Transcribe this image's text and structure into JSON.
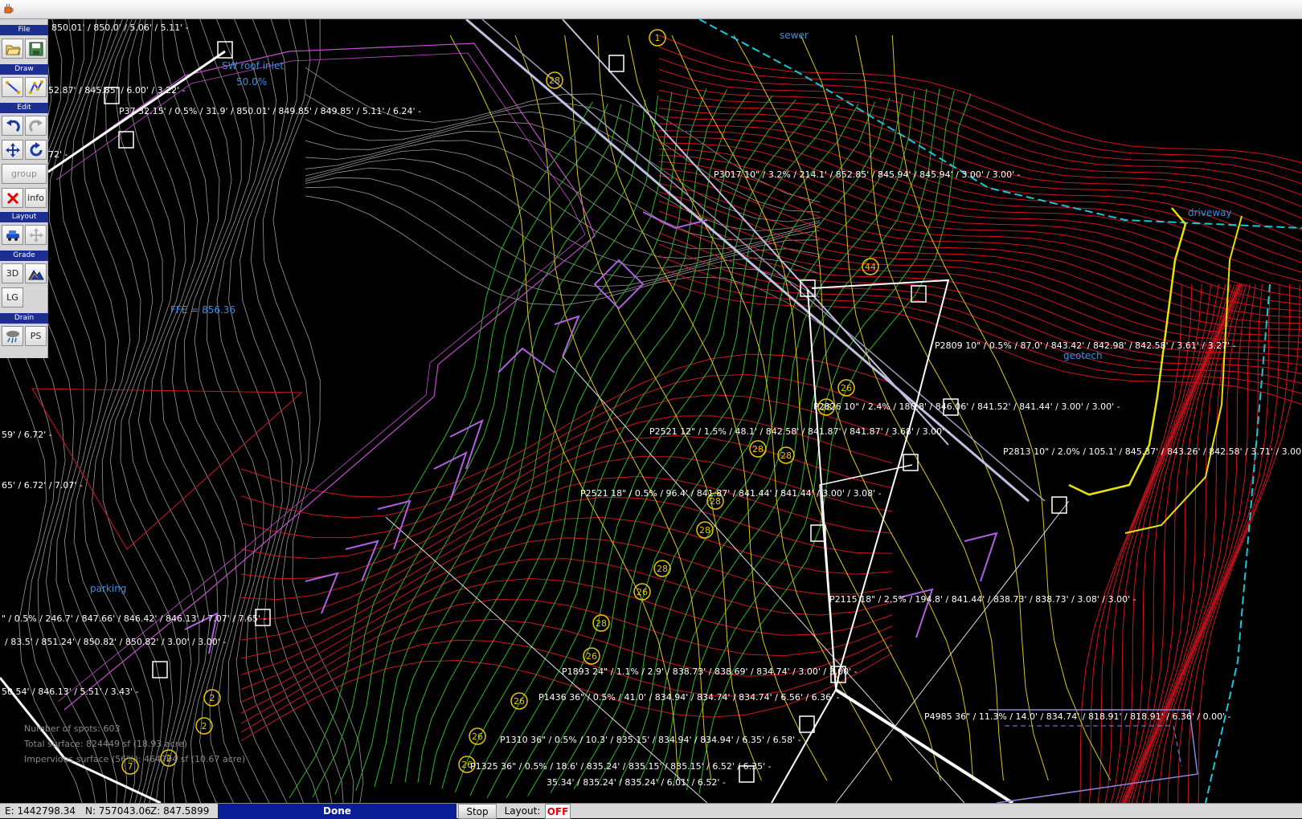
{
  "window": {
    "icon": "java-coffee-icon"
  },
  "toolbar": {
    "file": {
      "title": "File",
      "icons": [
        "open-folder-icon",
        "save-disk-icon"
      ]
    },
    "draw": {
      "title": "Draw",
      "icons": [
        "draw-line-icon",
        "draw-polyline-icon"
      ]
    },
    "edit": {
      "title": "Edit",
      "icons": [
        "undo-icon",
        "redo-icon",
        "move-icon",
        "rotate-icon"
      ],
      "group_label": "group",
      "delete_icon": "delete-x-icon",
      "info_label": "info"
    },
    "layout": {
      "title": "Layout",
      "icons": [
        "layout-car-icon",
        "layout-move-icon"
      ]
    },
    "grade": {
      "title": "Grade",
      "btn_3d": "3D",
      "terrain_icon": "terrain-icon",
      "lg_label": "LG"
    },
    "drain": {
      "title": "Drain",
      "icon": "storm-drain-icon",
      "ps_label": "PS"
    }
  },
  "canvas": {
    "labels": [
      {
        "text": "850.01' / 850.0' / 5.06' / 5.11' -",
        "style": "white"
      },
      {
        "text": "SW roof inlet",
        "style": "blue"
      },
      {
        "text": "50.0%",
        "style": "blue"
      },
      {
        "text": "52.87' / 845.85' / 6.00' / 3.22' -",
        "style": "white"
      },
      {
        "text": "P37 32.15' / 0.5% / 31.9' / 850.01' / 849.85' / 849.85' / 5.11' / 6.24' -",
        "style": "white"
      },
      {
        "text": "72' -",
        "style": "white"
      },
      {
        "text": "sewer",
        "style": "blue"
      },
      {
        "text": "P3017 10\" / 3.2% / 214.1' / 852.85' / 845.94' / 845.94' / 3.00' / 3.00' -",
        "style": "white"
      },
      {
        "text": "driveway",
        "style": "blue"
      },
      {
        "text": "FFE = 856.36",
        "style": "blue"
      },
      {
        "text": "P2809 10\" / 0.5% / 87.0' / 843.42' / 842.98' / 842.58' / 3.61' / 3.27' -",
        "style": "white"
      },
      {
        "text": "geotech",
        "style": "blue"
      },
      {
        "text": "P2826 10\" / 2.4% / 180.8' / 846.06' / 841.52' / 841.44' / 3.00' / 3.00' -",
        "style": "white"
      },
      {
        "text": "P2521 12\" / 1.5% / 48.1' / 842.58' / 841.87' / 841.87' / 3.68' / 3.00' -",
        "style": "white"
      },
      {
        "text": "59' / 6.72' -",
        "style": "white"
      },
      {
        "text": "P2813 10\" / 2.0% / 105.1' / 845.37' / 843.26' / 842.58' / 3.71' / 3.00' -",
        "style": "white"
      },
      {
        "text": "65' / 6.72' / 7.07' -",
        "style": "white"
      },
      {
        "text": "P2521 18\" / 0.5% / 96.4' / 841.87' / 841.44' / 841.44' / 3.00' / 3.08' -",
        "style": "white"
      },
      {
        "text": "parking",
        "style": "blue"
      },
      {
        "text": "\" / 0.5% / 246.7' / 847.66' / 846.42' / 846.13' / 7.07' / 7.65' -",
        "style": "white"
      },
      {
        "text": "P2115 18\" / 2.5% / 194.8' / 841.44' / 838.73' / 838.73' / 3.08' / 3.00' -",
        "style": "white"
      },
      {
        "text": "/ 83.5' / 851.24' / 850.82' / 850.82' / 3.00' / 3.00' -",
        "style": "white"
      },
      {
        "text": "P1893 24\" / 1.1% / 2.9' / 838.73' / 838.69' / 834.74' / 3.00' / 3.00' -",
        "style": "white"
      },
      {
        "text": "50.54' / 846.13' / 5.51' / 3.43' -",
        "style": "white"
      },
      {
        "text": "P1436 36\" / 0.5% / 41.0' / 834.94' / 834.74' / 834.74' / 6.56' / 6.36' -",
        "style": "white"
      },
      {
        "text": "P4985 36\" / 11.3% / 14.0' / 834.74' / 818.91' / 818.91' / 6.36' / 0.00' -",
        "style": "white"
      },
      {
        "text": "Number of spots: 603",
        "style": "gray"
      },
      {
        "text": "Total surface: 824449 sf (18.93 acre)",
        "style": "gray"
      },
      {
        "text": "Impervious surface (56%): 464794 sf (10.67 acre)",
        "style": "gray"
      },
      {
        "text": "P1310 36\" / 0.5% / 10.3' / 835.15' / 834.94' / 834.94' / 6.35' / 6.58' -",
        "style": "white"
      },
      {
        "text": "P1325 36\" / 0.5% / 18.6' / 835.24' / 835.15' / 835.15' / 6.52' / 6.35' -",
        "style": "white"
      },
      {
        "text": "35.34' / 835.24' / 835.24' / 6.01' / 6.52' -",
        "style": "white"
      }
    ],
    "markers": [
      "1",
      "28",
      "44",
      "26",
      "28",
      "28",
      "28",
      "28",
      "28",
      "28",
      "26",
      "28",
      "26",
      "26",
      "2",
      "2",
      "26",
      "26",
      "7",
      "2"
    ],
    "colors": {
      "contour_red": "#d4141e",
      "contour_green": "#2fb52f",
      "contour_yellow": "#d6c81c",
      "contour_gray": "#9a9a9a",
      "pipe_white": "#ffffff",
      "marker_yellow": "#e6c800",
      "property_cyan": "#16c8d8",
      "magenta_line": "#c84ad0",
      "label_blue": "#3a8fe0"
    }
  },
  "status": {
    "easting": "E: 1442798.34",
    "northing": "N: 757043.06",
    "elevation": "Z: 847.5899",
    "message": "Done",
    "stop_label": "Stop",
    "layout_label": "Layout:",
    "layout_state": "OFF"
  }
}
